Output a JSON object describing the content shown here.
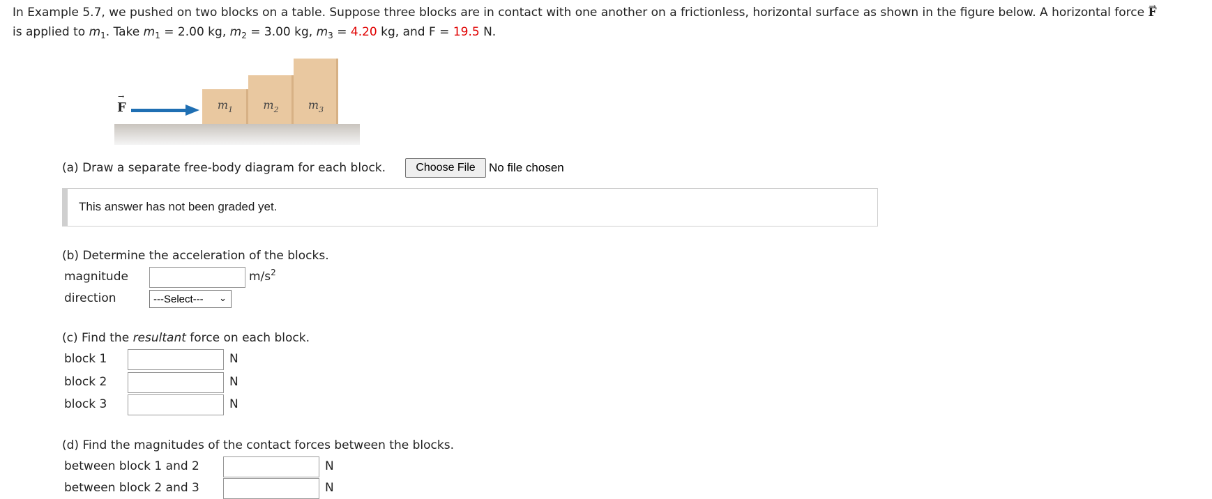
{
  "intro": {
    "line1": "In Example 5.7, we pushed on two blocks on a table. Suppose three blocks are in contact with one another on a frictionless, horizontal surface as shown in the figure below. A horizontal force",
    "force_symbol": "F",
    "line2_start": "is applied to",
    "m_symbol": "m",
    "m1_sub": "1",
    "m2_sub": "2",
    "m3_sub": "3",
    "take": ". Take",
    "m1_value": " = 2.00 kg,",
    "m2_value": " = 3.00 kg,",
    "m3_eq": " = ",
    "m3_value": "4.20",
    "and_f": " kg, and F = ",
    "f_value": "19.5",
    "f_unit": " N."
  },
  "figure": {
    "force_label": "F",
    "block1_label": "m",
    "block1_sub": "1",
    "block2_label": "m",
    "block2_sub": "2",
    "block3_label": "m",
    "block3_sub": "3",
    "colors": {
      "block": "#e9c8a0",
      "arrow": "#1f6fb3"
    }
  },
  "part_a": {
    "prompt": "(a) Draw a separate free-body diagram for each block.",
    "file_button": "Choose File",
    "file_status": "No file chosen",
    "grading_status": "This answer has not been graded yet."
  },
  "part_b": {
    "prompt": "(b) Determine the acceleration of the blocks.",
    "magnitude_label": "magnitude",
    "magnitude_value": "",
    "unit": "m/s",
    "unit_exp": "2",
    "direction_label": "direction",
    "direction_selected": "---Select---"
  },
  "part_c": {
    "prompt_start": "(c) Find the ",
    "prompt_em": "resultant",
    "prompt_end": " force on each block.",
    "rows": [
      {
        "label": "block 1",
        "value": "",
        "unit": "N"
      },
      {
        "label": "block 2",
        "value": "",
        "unit": "N"
      },
      {
        "label": "block 3",
        "value": "",
        "unit": "N"
      }
    ]
  },
  "part_d": {
    "prompt": "(d) Find the magnitudes of the contact forces between the blocks.",
    "rows": [
      {
        "label": "between block 1 and 2",
        "value": "",
        "unit": "N"
      },
      {
        "label": "between block 2 and 3",
        "value": "",
        "unit": "N"
      }
    ]
  },
  "accent_red": "#e00000"
}
